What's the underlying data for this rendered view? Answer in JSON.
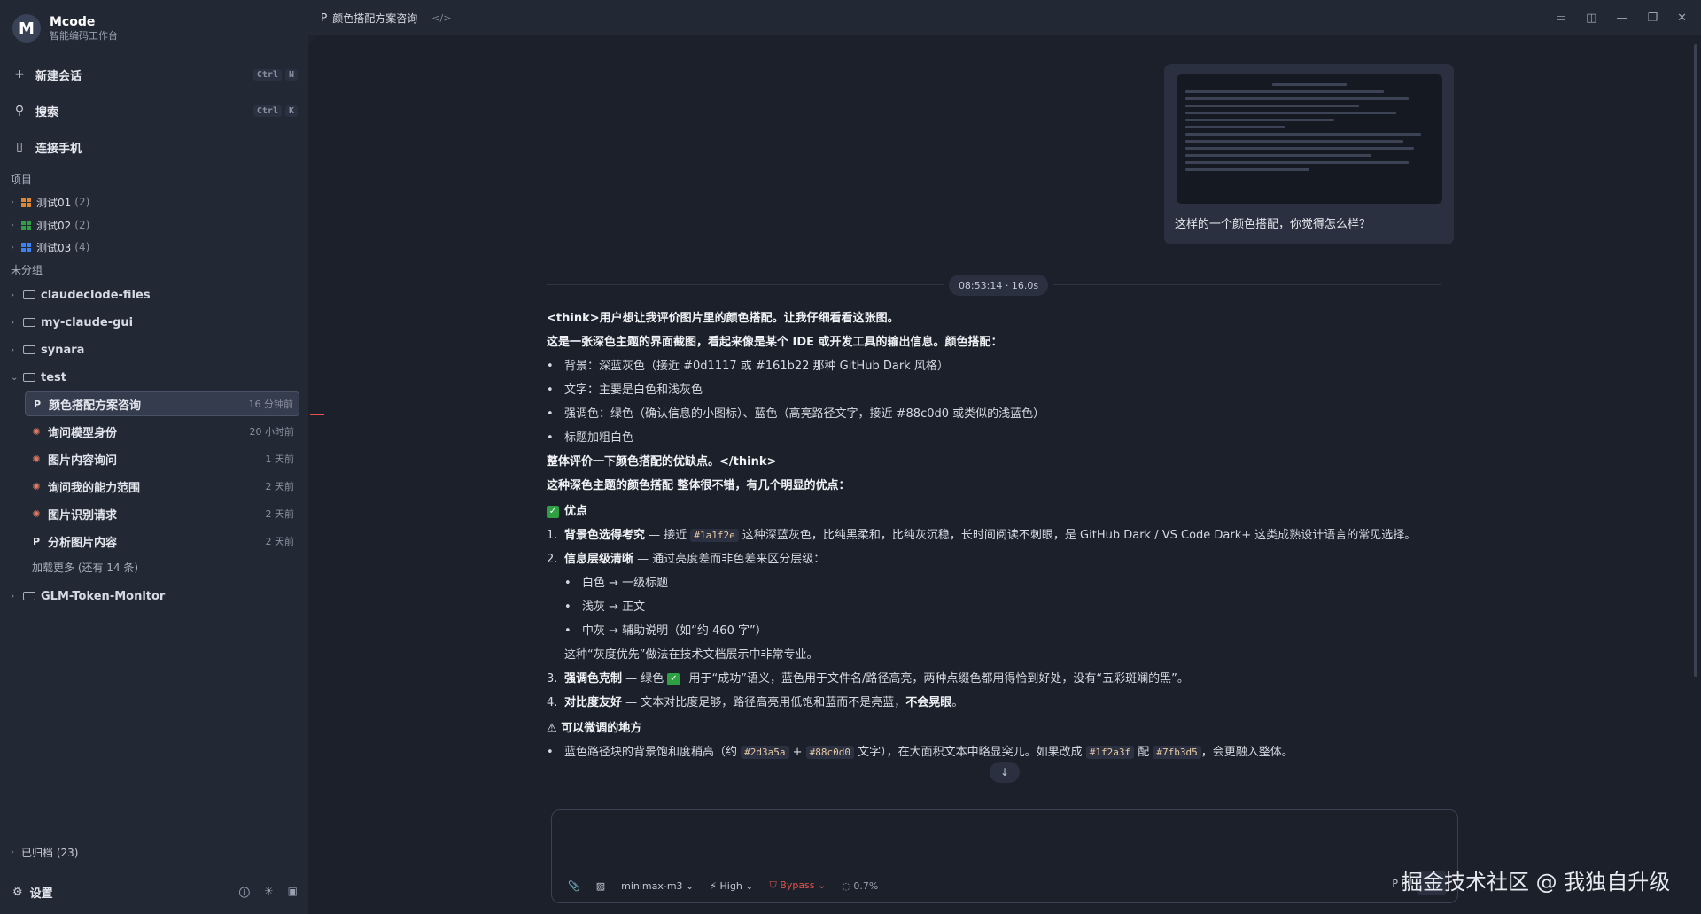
{
  "app": {
    "name": "Mcode",
    "subtitle": "智能编码工作台",
    "logo_letter": "M"
  },
  "sidebar": {
    "new_chat": {
      "label": "新建会话",
      "keys": [
        "Ctrl",
        "N"
      ]
    },
    "search": {
      "label": "搜索",
      "keys": [
        "Ctrl",
        "K"
      ]
    },
    "connect_phone": {
      "label": "连接手机"
    },
    "projects_label": "项目",
    "projects": [
      {
        "name": "测试01",
        "count": "(2)",
        "color": "#e0862f"
      },
      {
        "name": "测试02",
        "count": "(2)",
        "color": "#2ea043"
      },
      {
        "name": "测试03",
        "count": "(4)",
        "color": "#3b82f6"
      }
    ],
    "ungrouped_label": "未分组",
    "folders": [
      "claudeclode-files",
      "my-claude-gui",
      "synara",
      "test"
    ],
    "sessions": [
      {
        "title": "颜色搭配方案咨询",
        "time": "16 分钟前",
        "icon": "pi-icon",
        "active": true
      },
      {
        "title": "询问模型身份",
        "time": "20 小时前",
        "icon": "claude-icon"
      },
      {
        "title": "图片内容询问",
        "time": "1 天前",
        "icon": "claude-icon"
      },
      {
        "title": "询问我的能力范围",
        "time": "2 天前",
        "icon": "claude-icon"
      },
      {
        "title": "图片识别请求",
        "time": "2 天前",
        "icon": "claude-icon"
      },
      {
        "title": "分析图片内容",
        "time": "2 天前",
        "icon": "pi-icon"
      }
    ],
    "load_more": "加载更多 (还有 14 条)",
    "glm_folder": "GLM-Token-Monitor",
    "archived": "已归档 (23)",
    "settings": "设置"
  },
  "topbar": {
    "title": "颜色搭配方案咨询"
  },
  "user_message": {
    "text": "这样的一个颜色搭配，你觉得怎么样？"
  },
  "timestamp": "08:53:14 · 16.0s",
  "assistant": {
    "think_open": "<think>用户想让我评价图片里的颜色搭配。让我仔细看看这张图。",
    "p1": "这是一张深色主题的界面截图，看起来像是某个 IDE 或开发工具的输出信息。颜色搭配：",
    "bullets1": [
      "背景：深蓝灰色（接近 #0d1117 或 #161b22 那种 GitHub Dark 风格）",
      "文字：主要是白色和浅灰色",
      "强调色：绿色（确认信息的小图标）、蓝色（高亮路径文字，接近 #88c0d0 或类似的浅蓝色）",
      "标题加粗白色"
    ],
    "think_close": "整体评价一下颜色搭配的优缺点。</think>",
    "summary_a": "这种深色主题的颜色搭配 ",
    "summary_b": "整体很不错",
    "summary_c": "，有几个明显的优点：",
    "pros_title": "优点",
    "item1_bold": "背景色选得考究",
    "item1_a": " — 接近 ",
    "item1_code": "#1a1f2e",
    "item1_b": " 这种深蓝灰色，比纯黑柔和，比纯灰沉稳，长时间阅读不刺眼，是 GitHub Dark / VS Code Dark+ 这类成熟设计语言的常见选择。",
    "item2_bold": "信息层级清晰",
    "item2_text": " — 通过亮度差而非色差来区分层级：",
    "levels": [
      "白色 → 一级标题",
      "浅灰 → 正文",
      "中灰 → 辅助说明（如“约 460 字”）"
    ],
    "gray_note": "这种“灰度优先”做法在技术文档展示中非常专业。",
    "item3_bold": "强调色克制",
    "item3_a": " — 绿色 ",
    "item3_b": " 用于“成功”语义，蓝色用于文件名/路径高亮，两种点缀色都用得恰到好处，没有“五彩斑斓的黑”。",
    "item4_bold": "对比度友好",
    "item4_a": " — 文本对比度足够，路径高亮用低饱和蓝而不是亮蓝，",
    "item4_b": "不会晃眼",
    "item4_c": "。",
    "tweak_title": "可以微调的地方",
    "tweak_a": "蓝色路径块的背景饱和度稍高（约 ",
    "tweak_code1": "#2d3a5a",
    "tweak_plus": " + ",
    "tweak_code2": "#88c0d0",
    "tweak_b": " 文字），在大面积文本中略显突兀。如果改成 ",
    "tweak_code3": "#1f2a3f",
    "tweak_mid": " 配 ",
    "tweak_code4": "#7fb3d5",
    "tweak_c": "，会更融入整体。"
  },
  "composer": {
    "model": "minimax-m3",
    "effort": "High",
    "mode": "Bypass",
    "context_pct": "0.7%",
    "agent": "Pi"
  },
  "watermark": "掘金技术社区 @ 我独自升级",
  "colors": {
    "accent_green": "#2ea043",
    "bypass_red": "#e5534b",
    "bg": "#1c202b"
  }
}
